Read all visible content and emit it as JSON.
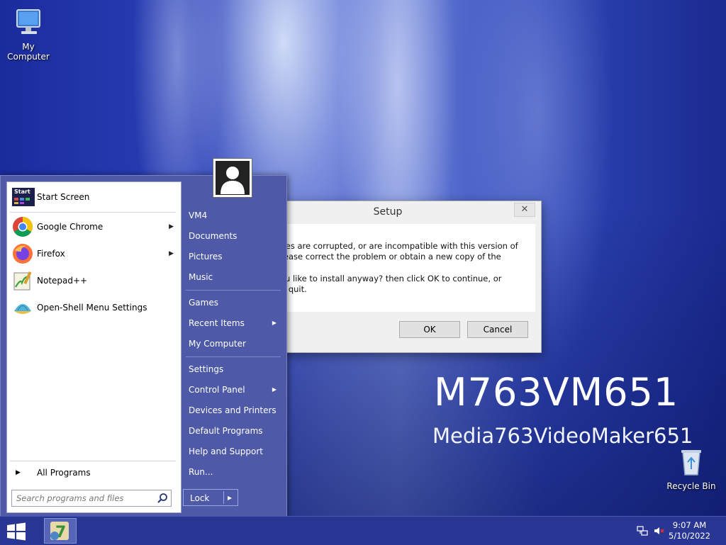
{
  "desktop": {
    "icons": {
      "my_computer": "My Computer",
      "recycle_bin": "Recycle Bin"
    },
    "watermark_title": "M763VM651",
    "watermark_subtitle": "Media763VideoMaker651"
  },
  "dialog": {
    "title": "Setup",
    "close_glyph": "✕",
    "message1": "Theme files are corrupted, or are incompatible with this version of Setup. Please correct the problem or obtain a new copy of the program.",
    "message2": "Would you like to install anyway? then click OK to continue, or Cancel to quit.",
    "ok_label": "OK",
    "cancel_label": "Cancel"
  },
  "start_menu": {
    "start_screen_label": "Start Screen",
    "start_tile_text": "Start",
    "pinned": [
      {
        "label": "Google Chrome",
        "has_submenu": true
      },
      {
        "label": "Firefox",
        "has_submenu": true
      },
      {
        "label": "Notepad++",
        "has_submenu": false
      },
      {
        "label": "Open-Shell Menu Settings",
        "has_submenu": false
      }
    ],
    "all_programs": "All Programs",
    "search_placeholder": "Search programs and files",
    "right": {
      "user": "VM4",
      "documents": "Documents",
      "pictures": "Pictures",
      "music": "Music",
      "games": "Games",
      "recent_items": "Recent Items",
      "my_computer": "My Computer",
      "settings": "Settings",
      "control_panel": "Control Panel",
      "devices_printers": "Devices and Printers",
      "default_programs": "Default Programs",
      "help_support": "Help and Support",
      "run": "Run..."
    },
    "lock_label": "Lock"
  },
  "taskbar": {
    "time": "9:07 AM",
    "date": "5/10/2022"
  },
  "colors": {
    "menu_bg": "#4e5aa8",
    "taskbar_bg": "#2a3693"
  }
}
